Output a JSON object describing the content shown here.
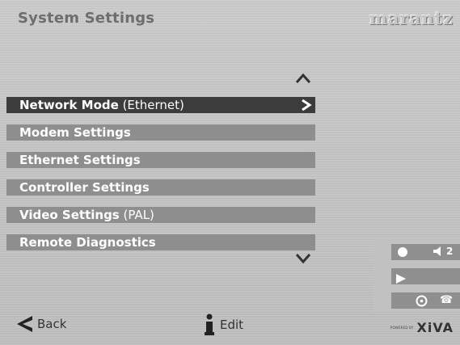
{
  "header": {
    "title": "System Settings",
    "brand": "marantz"
  },
  "menu": {
    "items": [
      {
        "label": "Network Mode",
        "suffix": " (Ethernet)",
        "selected": true
      },
      {
        "label": "Modem Settings",
        "suffix": ""
      },
      {
        "label": "Ethernet Settings",
        "suffix": ""
      },
      {
        "label": "Controller Settings",
        "suffix": ""
      },
      {
        "label": "Video Settings",
        "suffix": " (PAL)"
      },
      {
        "label": "Remote Diagnostics",
        "suffix": ""
      }
    ]
  },
  "status": {
    "volume_level": "2",
    "icons": [
      "record-dot-icon",
      "volume-icon",
      "play-icon",
      "disc-icon",
      "phone-icon"
    ]
  },
  "footer": {
    "back_label": "Back",
    "edit_label": "Edit",
    "powered_by": "POWERED BY",
    "platform": "XiVA"
  },
  "colors": {
    "selected_bg": "#3c3c3c",
    "item_bg": "#8e8e8e",
    "text_white": "#ffffff"
  }
}
